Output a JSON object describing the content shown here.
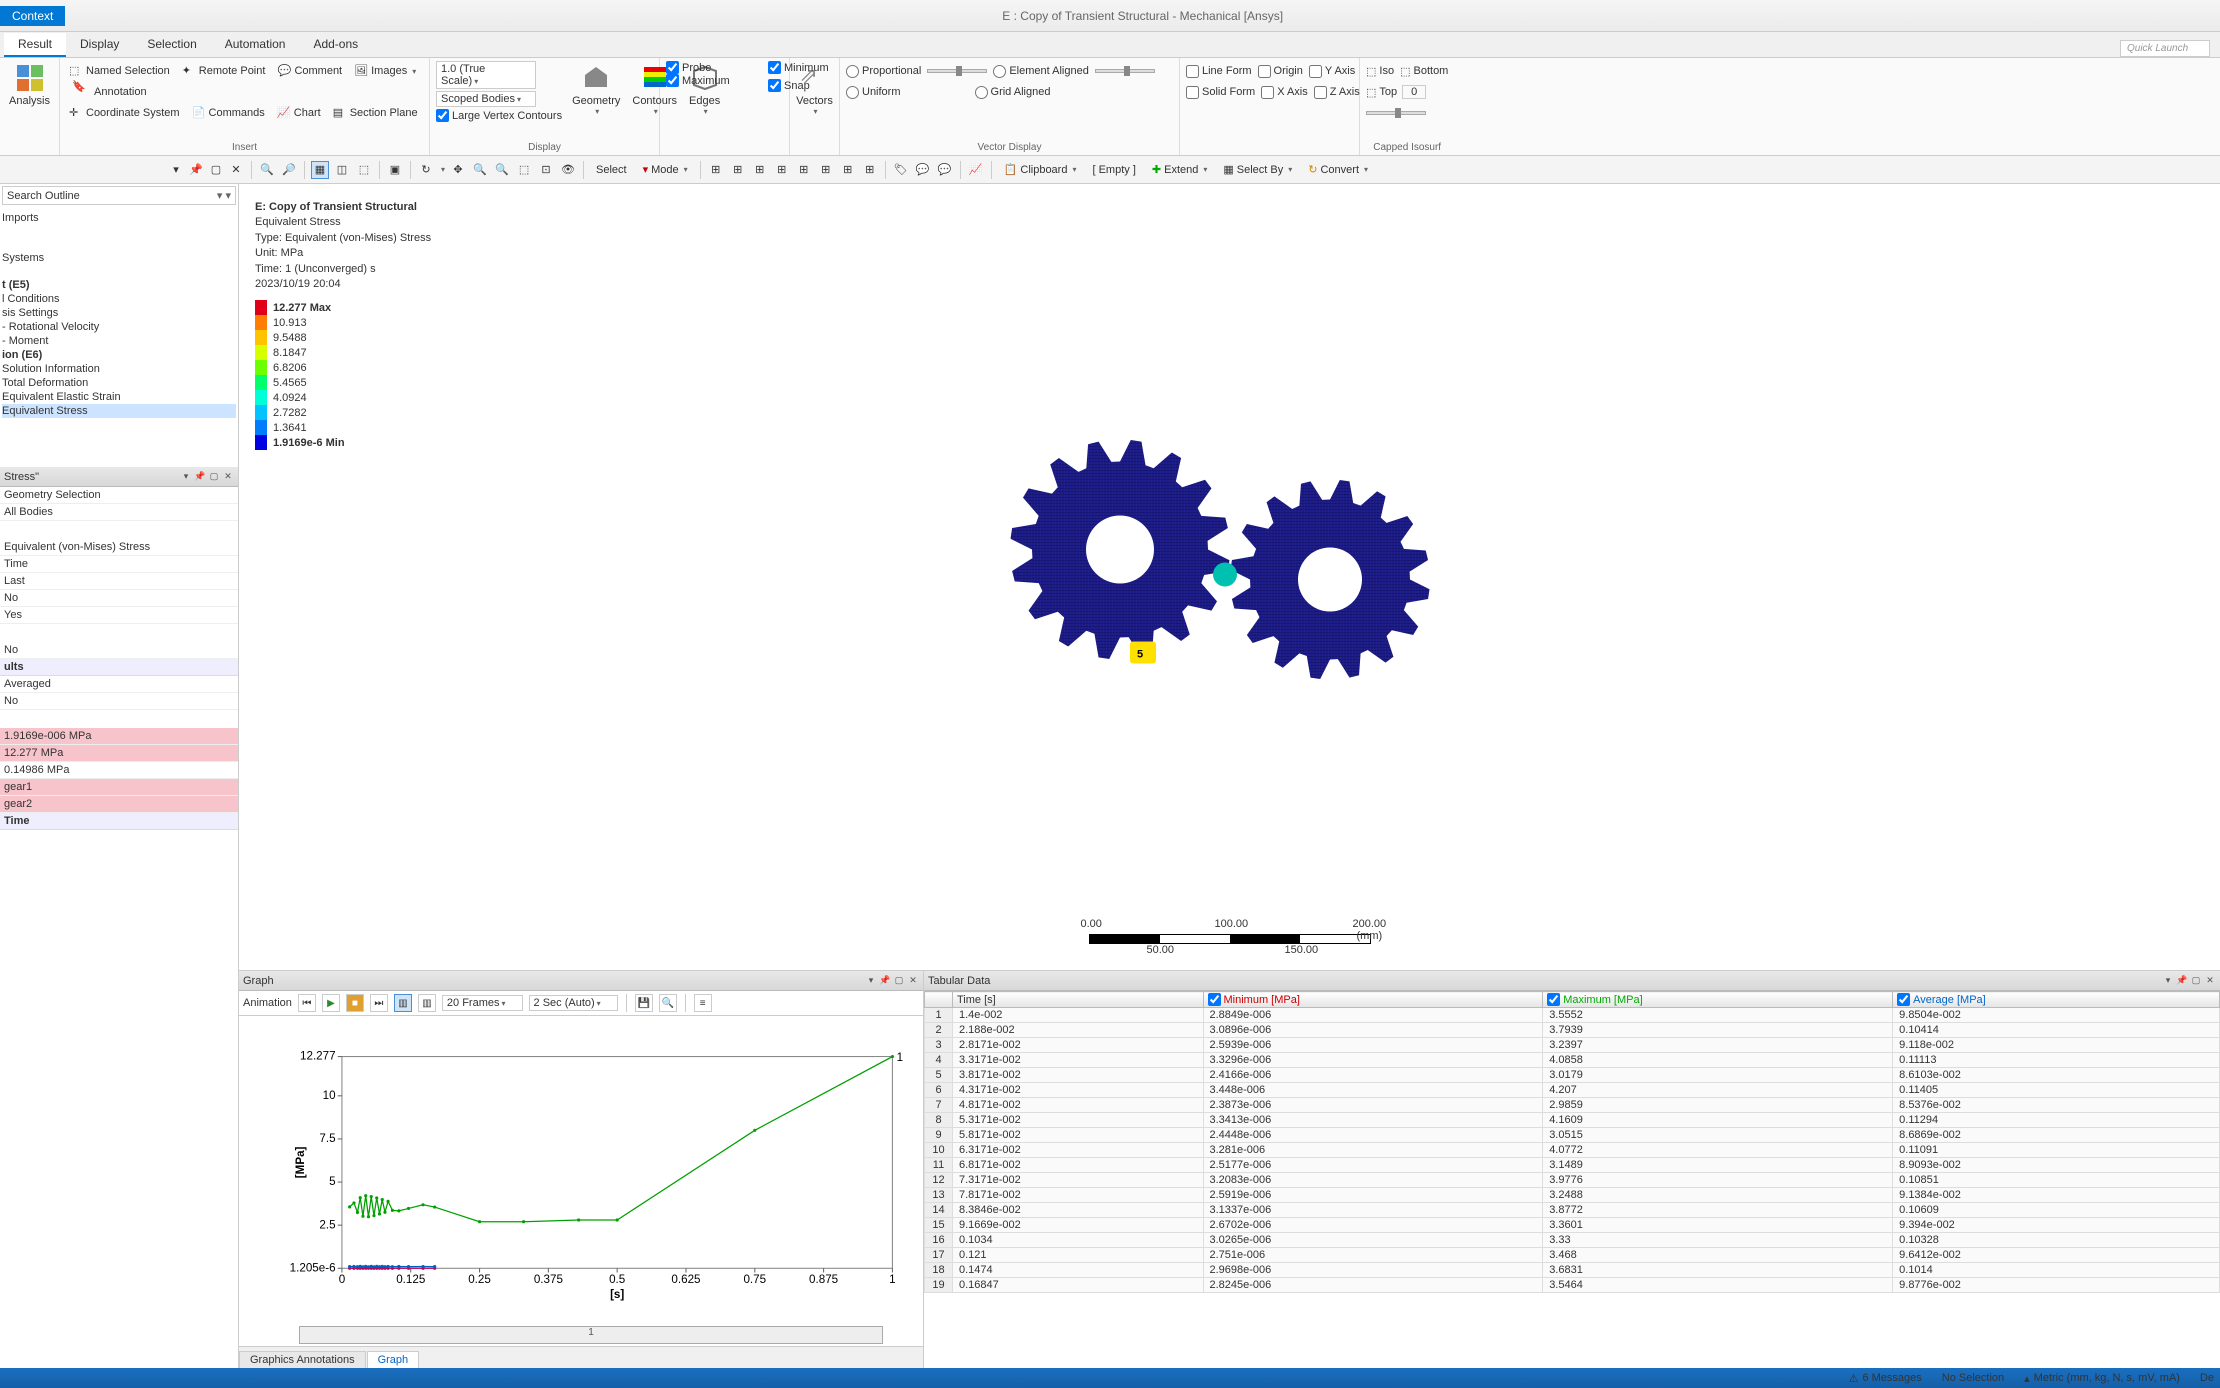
{
  "title_bar": {
    "context_tab": "Context",
    "title": "E : Copy of Transient Structural - Mechanical [Ansys]"
  },
  "ribbon_tabs": [
    "Result",
    "Display",
    "Selection",
    "Automation",
    "Add-ons"
  ],
  "quick_launch": "Quick Launch",
  "ribbon": {
    "analysis_btn": "Analysis",
    "insert_group": "Insert",
    "named_selection": "Named Selection",
    "remote_point": "Remote Point",
    "comment": "Comment",
    "images": "Images",
    "annotation": "Annotation",
    "coord_sys": "Coordinate System",
    "commands": "Commands",
    "chart": "Chart",
    "section_plane": "Section Plane",
    "scale_combo": "1.0 (True Scale)",
    "scoped_bodies": "Scoped Bodies",
    "large_vertex": "Large Vertex Contours",
    "geometry": "Geometry",
    "contours": "Contours",
    "edges": "Edges",
    "display_group": "Display",
    "probe": "Probe",
    "minimum": "Minimum",
    "maximum": "Maximum",
    "snap": "Snap",
    "vectors": "Vectors",
    "proportional": "Proportional",
    "uniform": "Uniform",
    "element_aligned": "Element Aligned",
    "grid_aligned": "Grid Aligned",
    "vector_display": "Vector Display",
    "line_form": "Line Form",
    "solid_form": "Solid Form",
    "origin": "Origin",
    "x_axis": "X Axis",
    "y_axis": "Y Axis",
    "z_axis": "Z Axis",
    "iso": "Iso",
    "top": "Top",
    "bottom": "Bottom",
    "capped_iso": "Capped Isosurf"
  },
  "toolbar": {
    "select": "Select",
    "mode": "Mode",
    "clipboard": "Clipboard",
    "empty": "[ Empty ]",
    "extend": "Extend",
    "select_by": "Select By",
    "convert": "Convert"
  },
  "tree": {
    "search": "Search Outline",
    "imports": "Imports",
    "systems": "Systems",
    "item_e5": "t (E5)",
    "conditions": "l Conditions",
    "settings": "sis Settings",
    "rot_vel": "- Rotational Velocity",
    "moment": "- Moment",
    "item_e6": "ion (E6)",
    "sol_info": "Solution Information",
    "tot_def": "Total Deformation",
    "eq_strain": "Equivalent Elastic Strain",
    "eq_stress": "Equivalent Stress"
  },
  "details": {
    "panel_title": "Stress\"",
    "geom_sel_label": "Geometry Selection",
    "geom_sel_val": "",
    "all_bodies": "All Bodies",
    "eq_stress": "Equivalent (von-Mises) Stress",
    "time": "Time",
    "last": "Last",
    "no1": "No",
    "yes": "Yes",
    "no2": "No",
    "results_hdr": "ults",
    "averaged": "Averaged",
    "no3": "No",
    "min_val": "1.9169e-006 MPa",
    "max_val": "12.277 MPa",
    "avg_val": "0.14986 MPa",
    "gear1": "gear1",
    "gear2": "gear2",
    "time2": "Time"
  },
  "legend": {
    "title": "E: Copy of Transient Structural",
    "subtitle": "Equivalent Stress",
    "type": "Type: Equivalent (von-Mises) Stress",
    "unit": "Unit: MPa",
    "time_line": "Time: 1 (Unconverged) s",
    "date": "2023/10/19 20:04",
    "max": "12.277 Max",
    "steps": [
      "10.913",
      "9.5488",
      "8.1847",
      "6.8206",
      "5.4565",
      "4.0924",
      "2.7282",
      "1.3641"
    ],
    "min": "1.9169e-6 Min",
    "colors": [
      "#e0001a",
      "#ff7d00",
      "#ffc300",
      "#d6ff00",
      "#6bff00",
      "#00ff6b",
      "#00ffd6",
      "#00c3ff",
      "#007dff",
      "#0000e0"
    ]
  },
  "scale": {
    "v0": "0.00",
    "v50": "50.00",
    "v100": "100.00",
    "v150": "150.00",
    "v200": "200.00 (mm)"
  },
  "graph": {
    "panel": "Graph",
    "animation": "Animation",
    "frames": "20 Frames",
    "loop": "2 Sec (Auto)",
    "tabs": {
      "annotations": "Graphics Annotations",
      "graph": "Graph"
    }
  },
  "chart_data": {
    "type": "line",
    "xlabel": "[s]",
    "ylabel": "[MPa]",
    "xlim": [
      0,
      1
    ],
    "ylim": [
      0,
      12.277
    ],
    "xticks": [
      0,
      0.125,
      0.25,
      0.375,
      0.5,
      0.625,
      0.75,
      0.875,
      1
    ],
    "yticks": [
      1.2046e-06,
      2.5,
      5.0,
      7.5,
      10.0,
      12.277
    ],
    "series": [
      {
        "name": "Minimum",
        "color": "#c00060",
        "x": [
          0.014,
          0.0219,
          0.0282,
          0.0332,
          0.0382,
          0.0432,
          0.0482,
          0.0532,
          0.0582,
          0.0632,
          0.0682,
          0.0732,
          0.0782,
          0.0838,
          0.0917,
          0.1034,
          0.121,
          0.1474,
          0.16847
        ],
        "y": [
          2.88e-06,
          3.09e-06,
          2.59e-06,
          3.33e-06,
          2.42e-06,
          3.45e-06,
          2.39e-06,
          3.34e-06,
          2.45e-06,
          3.28e-06,
          2.52e-06,
          3.21e-06,
          2.59e-06,
          3.13e-06,
          2.67e-06,
          3.03e-06,
          2.75e-06,
          2.97e-06,
          2.82e-06
        ]
      },
      {
        "name": "Maximum",
        "color": "#00a000",
        "x": [
          0.014,
          0.0219,
          0.0282,
          0.0332,
          0.0382,
          0.0432,
          0.0482,
          0.0532,
          0.0582,
          0.0632,
          0.0682,
          0.0732,
          0.0782,
          0.0838,
          0.0917,
          0.1034,
          0.121,
          0.1474,
          0.16847,
          0.25,
          0.33,
          0.43,
          0.5,
          0.75,
          1.0
        ],
        "y": [
          3.56,
          3.79,
          3.24,
          4.09,
          3.02,
          4.21,
          2.99,
          4.16,
          3.05,
          4.08,
          3.15,
          3.98,
          3.25,
          3.88,
          3.36,
          3.33,
          3.47,
          3.68,
          3.55,
          2.7,
          2.7,
          2.8,
          2.8,
          8.0,
          12.277
        ]
      },
      {
        "name": "Average",
        "color": "#0060c0",
        "x": [
          0.014,
          0.0219,
          0.0282,
          0.0332,
          0.0382,
          0.0432,
          0.0482,
          0.0532,
          0.0582,
          0.0632,
          0.0682,
          0.0732,
          0.0782,
          0.0838,
          0.0917,
          0.1034,
          0.121,
          0.1474,
          0.16847
        ],
        "y": [
          0.099,
          0.104,
          0.092,
          0.111,
          0.086,
          0.115,
          0.085,
          0.113,
          0.087,
          0.111,
          0.09,
          0.109,
          0.092,
          0.106,
          0.094,
          0.103,
          0.096,
          0.101,
          0.096
        ]
      }
    ]
  },
  "tabular": {
    "panel": "Tabular Data",
    "headers": {
      "time": "Time [s]",
      "min": "Minimum [MPa]",
      "max": "Maximum [MPa]",
      "avg": "Average [MPa]"
    },
    "rows": [
      [
        "1",
        "1.4e-002",
        "2.8849e-006",
        "3.5552",
        "9.8504e-002"
      ],
      [
        "2",
        "2.188e-002",
        "3.0896e-006",
        "3.7939",
        "0.10414"
      ],
      [
        "3",
        "2.8171e-002",
        "2.5939e-006",
        "3.2397",
        "9.118e-002"
      ],
      [
        "4",
        "3.3171e-002",
        "3.3296e-006",
        "4.0858",
        "0.11113"
      ],
      [
        "5",
        "3.8171e-002",
        "2.4166e-006",
        "3.0179",
        "8.6103e-002"
      ],
      [
        "6",
        "4.3171e-002",
        "3.448e-006",
        "4.207",
        "0.11405"
      ],
      [
        "7",
        "4.8171e-002",
        "2.3873e-006",
        "2.9859",
        "8.5376e-002"
      ],
      [
        "8",
        "5.3171e-002",
        "3.3413e-006",
        "4.1609",
        "0.11294"
      ],
      [
        "9",
        "5.8171e-002",
        "2.4448e-006",
        "3.0515",
        "8.6869e-002"
      ],
      [
        "10",
        "6.3171e-002",
        "3.281e-006",
        "4.0772",
        "0.11091"
      ],
      [
        "11",
        "6.8171e-002",
        "2.5177e-006",
        "3.1489",
        "8.9093e-002"
      ],
      [
        "12",
        "7.3171e-002",
        "3.2083e-006",
        "3.9776",
        "0.10851"
      ],
      [
        "13",
        "7.8171e-002",
        "2.5919e-006",
        "3.2488",
        "9.1384e-002"
      ],
      [
        "14",
        "8.3846e-002",
        "3.1337e-006",
        "3.8772",
        "0.10609"
      ],
      [
        "15",
        "9.1669e-002",
        "2.6702e-006",
        "3.3601",
        "9.394e-002"
      ],
      [
        "16",
        "0.1034",
        "3.0265e-006",
        "3.33",
        "0.10328"
      ],
      [
        "17",
        "0.121",
        "2.751e-006",
        "3.468",
        "9.6412e-002"
      ],
      [
        "18",
        "0.1474",
        "2.9698e-006",
        "3.6831",
        "0.1014"
      ],
      [
        "19",
        "0.16847",
        "2.8245e-006",
        "3.5464",
        "9.8776e-002"
      ]
    ]
  },
  "status": {
    "messages": "6 Messages",
    "selection": "No Selection",
    "units": "Metric (mm, kg, N, s, mV, mA)",
    "deg": "De"
  }
}
